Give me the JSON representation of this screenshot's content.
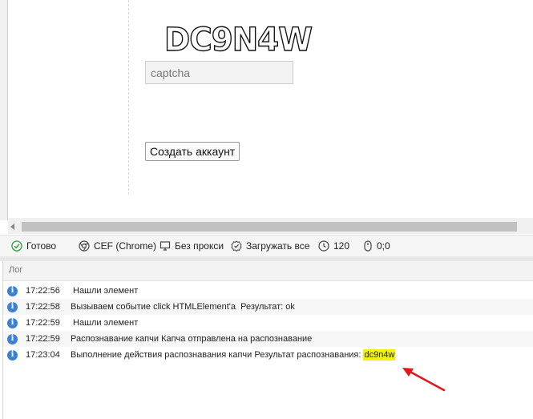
{
  "browser": {
    "captcha_text": "DC9N4W",
    "captcha_input_placeholder": "captcha",
    "create_button_label": "Создать аккаунт"
  },
  "status": {
    "ready": "Готово",
    "engine": "CEF (Chrome)",
    "proxy": "Без прокси",
    "load_all": "Загружать все",
    "timeout": "120",
    "cursor_pos": "0;0"
  },
  "log": {
    "title": "Лог",
    "rows": [
      {
        "time": "17:22:56",
        "text": " Нашли элемент"
      },
      {
        "time": "17:22:58",
        "text": "Вызываем событие click HTMLElement'a  Результат: ok"
      },
      {
        "time": "17:22:59",
        "text": " Нашли элемент"
      },
      {
        "time": "17:22:59",
        "text": "Распознавание капчи Капча отправлена на распознавание"
      },
      {
        "time": "17:23:04",
        "text": "Выполнение действия распознавания капчи Результат распознавания: ",
        "highlight": "dc9n4w"
      }
    ]
  },
  "colors": {
    "info_icon": "#3b82d6",
    "highlight": "#f2f20a",
    "arrow": "#e0191c",
    "ok_icon": "#2e9e3e"
  }
}
